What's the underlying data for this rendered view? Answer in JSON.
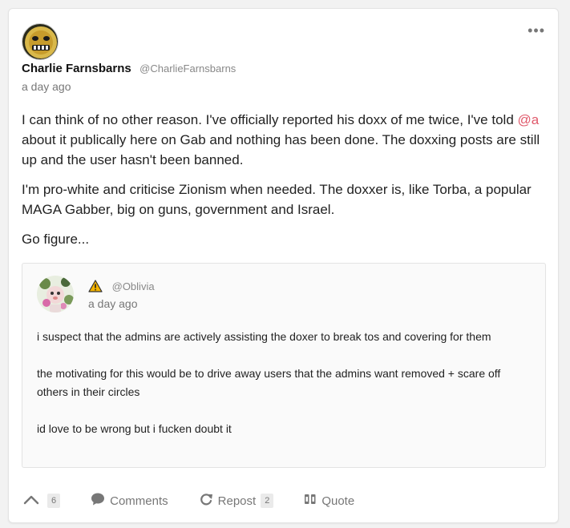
{
  "post": {
    "author": {
      "display_name": "Charlie Farnsbarns",
      "handle": "@CharlieFarnsbarns"
    },
    "timestamp": "a day ago",
    "body": {
      "p1_before": "I can think of no other reason. I've officially reported his doxx of me twice, I've told ",
      "p1_mention": "@a",
      "p1_after": " about it publically here on Gab and nothing has been done. The doxxing posts are still up and the user hasn't been banned.",
      "p2": "I'm pro-white and criticise Zionism when needed. The doxxer is, like Torba, a popular MAGA Gabber, big on guns, government and Israel.",
      "p3": "Go figure..."
    },
    "menu_icon": "more-horizontal-icon"
  },
  "quoted": {
    "handle": "@Oblivia",
    "timestamp": "a day ago",
    "warning_icon": "warning-icon",
    "paragraphs": [
      "i suspect that the admins are actively assisting the doxer to break tos and covering for them",
      "the motivating for this would be to drive away users that the admins want removed + scare off others in their circles",
      "id love to be wrong but i fucken doubt it"
    ]
  },
  "actions": {
    "upvote": {
      "icon": "chevron-up-icon",
      "count": "6"
    },
    "comments": {
      "icon": "comment-icon",
      "label": "Comments"
    },
    "repost": {
      "icon": "repost-icon",
      "label": "Repost",
      "count": "2"
    },
    "quote": {
      "icon": "quote-icon",
      "label": "Quote"
    }
  },
  "colors": {
    "mention": "#e0596b",
    "warning": "#f5b400",
    "muted": "#777777"
  }
}
